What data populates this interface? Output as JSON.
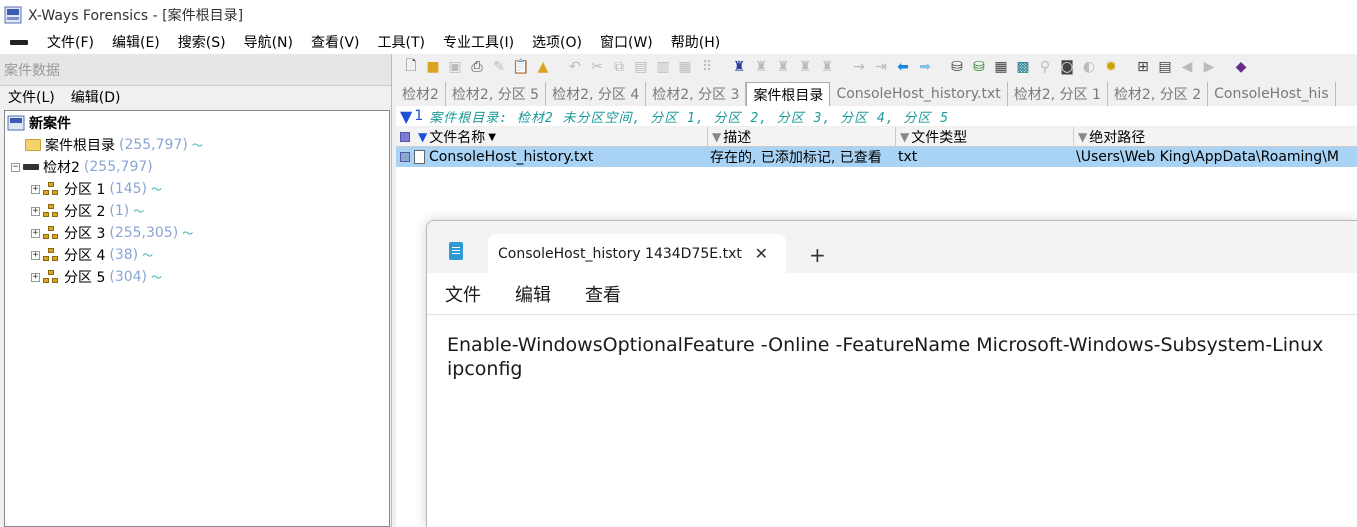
{
  "window": {
    "title": "X-Ways Forensics - [案件根目录]"
  },
  "menubar": [
    "文件(F)",
    "编辑(E)",
    "搜索(S)",
    "导航(N)",
    "查看(V)",
    "工具(T)",
    "专业工具(I)",
    "选项(O)",
    "窗口(W)",
    "帮助(H)"
  ],
  "left_pane": {
    "caption": "案件数据",
    "menu": [
      "文件(L)",
      "编辑(D)"
    ],
    "tree": {
      "root": "新案件",
      "case_root": {
        "label": "案件根目录",
        "count": "(255,797)"
      },
      "evidence": {
        "label": "检材2",
        "count": "(255,797)"
      },
      "partitions": [
        {
          "label": "分区 1",
          "count": "(145)"
        },
        {
          "label": "分区 2",
          "count": "(1)"
        },
        {
          "label": "分区 3",
          "count": "(255,305)"
        },
        {
          "label": "分区 4",
          "count": "(38)"
        },
        {
          "label": "分区 5",
          "count": "(304)"
        }
      ]
    }
  },
  "tabs": [
    "检材2",
    "检材2, 分区 5",
    "检材2, 分区 4",
    "检材2, 分区 3",
    "案件根目录",
    "ConsoleHost_history.txt",
    "检材2, 分区 1",
    "检材2, 分区 2",
    "ConsoleHost_his"
  ],
  "active_tab_index": 4,
  "filter_bar": {
    "count": "1",
    "text": "案件根目录: 检材2 未分区空间, 分区 1, 分区 2, 分区 3, 分区 4, 分区 5"
  },
  "grid": {
    "columns": [
      "文件名称",
      "描述",
      "文件类型",
      "绝对路径"
    ],
    "rows": [
      {
        "name": "ConsoleHost_history.txt",
        "description": "存在的, 已添加标记, 已查看",
        "type": "txt",
        "path": "\\Users\\Web King\\AppData\\Roaming\\M"
      }
    ]
  },
  "notepad": {
    "tab_title": "ConsoleHost_history 1434D75E.txt",
    "menu": [
      "文件",
      "编辑",
      "查看"
    ],
    "lines": [
      "Enable-WindowsOptionalFeature -Online -FeatureName Microsoft-Windows-Subsystem-Linux",
      "ipconfig"
    ]
  }
}
